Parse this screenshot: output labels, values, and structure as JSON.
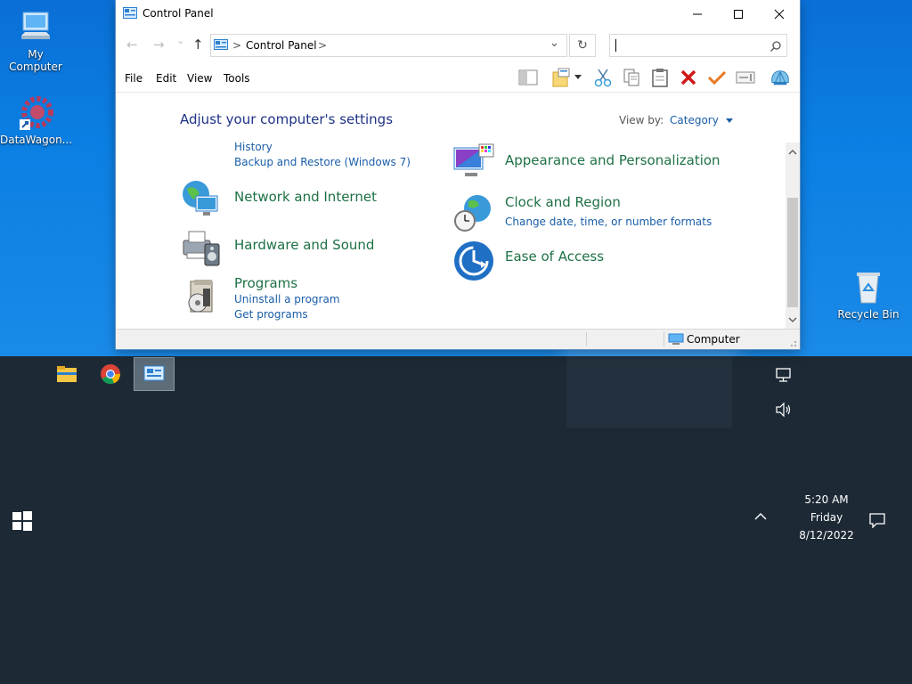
{
  "desktop": {
    "icons": [
      {
        "label": "My Computer"
      },
      {
        "label": "DataWagon..."
      },
      {
        "label": "Recycle Bin"
      }
    ]
  },
  "window": {
    "title": "Control Panel",
    "caption": {
      "minimize": "—",
      "maximize": "☐",
      "close": "✕"
    },
    "nav": {
      "back": "←",
      "forward": "→",
      "recent": "⌄",
      "up": "↑"
    },
    "address": {
      "path_sep": ">",
      "path": "Control Panel",
      "trail_sep": ">",
      "dropdown": "⌄"
    },
    "refresh": "↻",
    "search": {
      "placeholder": "",
      "value": ""
    },
    "menu": [
      "File",
      "Edit",
      "View",
      "Tools"
    ],
    "content": {
      "heading": "Adjust your computer's settings",
      "view_by_label": "View by:",
      "view_by_value": "Category",
      "left": [
        {
          "title": "",
          "links": [
            "History",
            "Backup and Restore (Windows 7)"
          ]
        },
        {
          "title": "Network and Internet",
          "links": []
        },
        {
          "title": "Hardware and Sound",
          "links": []
        },
        {
          "title": "Programs",
          "links": [
            "Uninstall a program",
            "Get programs"
          ]
        }
      ],
      "right": [
        {
          "title": "Appearance and Personalization",
          "links": []
        },
        {
          "title": "Clock and Region",
          "links": [
            "Change date, time, or number formats"
          ]
        },
        {
          "title": "Ease of Access",
          "links": []
        }
      ]
    },
    "status": {
      "location": "Computer"
    }
  },
  "taskbar": {
    "apps": [
      "file-explorer",
      "chrome",
      "control-panel"
    ],
    "active_app": "control-panel",
    "clock": {
      "time": "5:20 AM",
      "day": "Friday",
      "date": "8/12/2022"
    }
  },
  "colors": {
    "desktop_blue": "#0b7fe3",
    "taskbar": "#1d2a36",
    "category_green": "#1e7145",
    "link_blue": "#1a5ea8",
    "heading_blue": "#1e3287"
  }
}
